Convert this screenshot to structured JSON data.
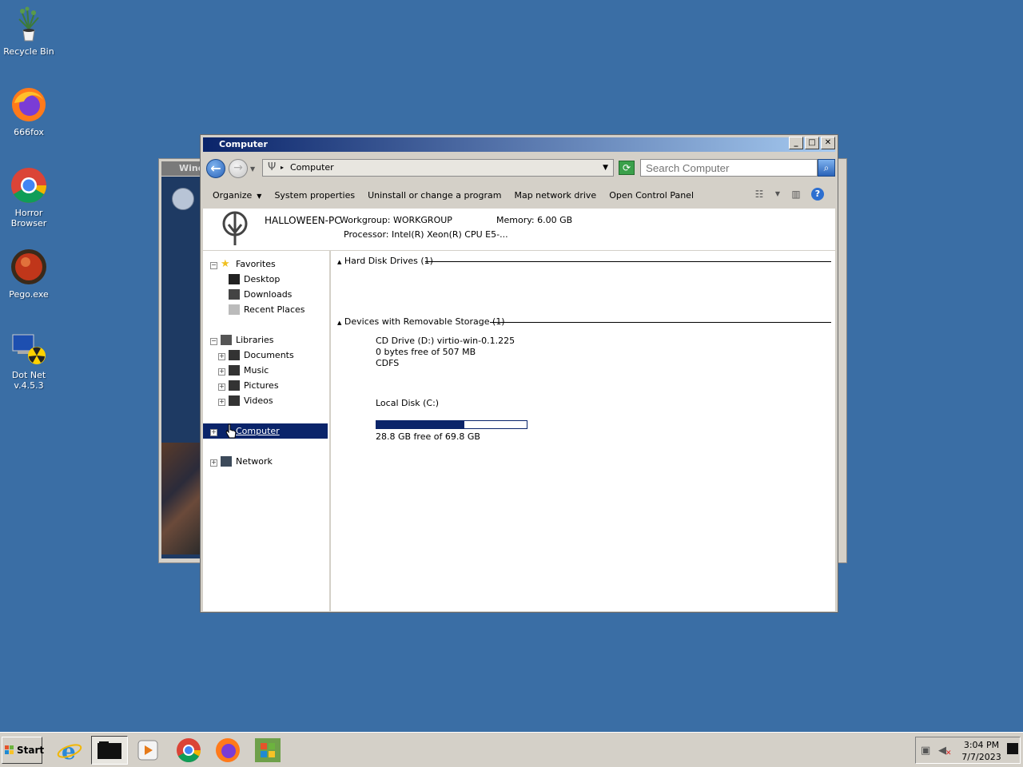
{
  "desktop": {
    "icons": [
      {
        "label": "Recycle Bin"
      },
      {
        "label": "666fox"
      },
      {
        "label": "Horror Browser"
      },
      {
        "label": "Pego.exe"
      },
      {
        "label": "Dot Net v.4.5.3"
      }
    ]
  },
  "background_window": {
    "title": "Wind"
  },
  "window": {
    "title": "Computer",
    "controls": {
      "minimize": "_",
      "maximize": "□",
      "close": "✕"
    },
    "address": {
      "location": "Computer"
    },
    "search": {
      "placeholder": "Search Computer"
    },
    "commands": {
      "organize": "Organize",
      "system_properties": "System properties",
      "uninstall": "Uninstall or change a program",
      "map_drive": "Map network drive",
      "control_panel": "Open Control Panel"
    },
    "info": {
      "pc_name": "HALLOWEEN-PC",
      "workgroup": "Workgroup: WORKGROUP",
      "memory": "Memory: 6.00 GB",
      "processor": "Processor: Intel(R) Xeon(R) CPU E5-..."
    },
    "nav": {
      "favorites": "Favorites",
      "desktop": "Desktop",
      "downloads": "Downloads",
      "recent_places": "Recent Places",
      "libraries": "Libraries",
      "documents": "Documents",
      "music": "Music",
      "pictures": "Pictures",
      "videos": "Videos",
      "computer": "Computer",
      "network": "Network"
    },
    "content": {
      "hdd_group": "Hard Disk Drives (1)",
      "local_disk": {
        "name": "Local Disk (C:)",
        "free": "28.8 GB free of 69.8 GB",
        "used_fraction": 0.587
      },
      "removable_group": "Devices with Removable Storage (1)",
      "cd_drive": {
        "name": "CD Drive (D:) virtio-win-0.1.225",
        "free": "0 bytes free of 507 MB",
        "fs": "CDFS"
      }
    }
  },
  "taskbar": {
    "start": "Start",
    "clock_time": "3:04 PM",
    "clock_date": "7/7/2023"
  },
  "colors": {
    "desktop": "#3a6ea5",
    "selection": "#0a246a",
    "title_start": "#0a246a",
    "title_end": "#a6caf0"
  }
}
